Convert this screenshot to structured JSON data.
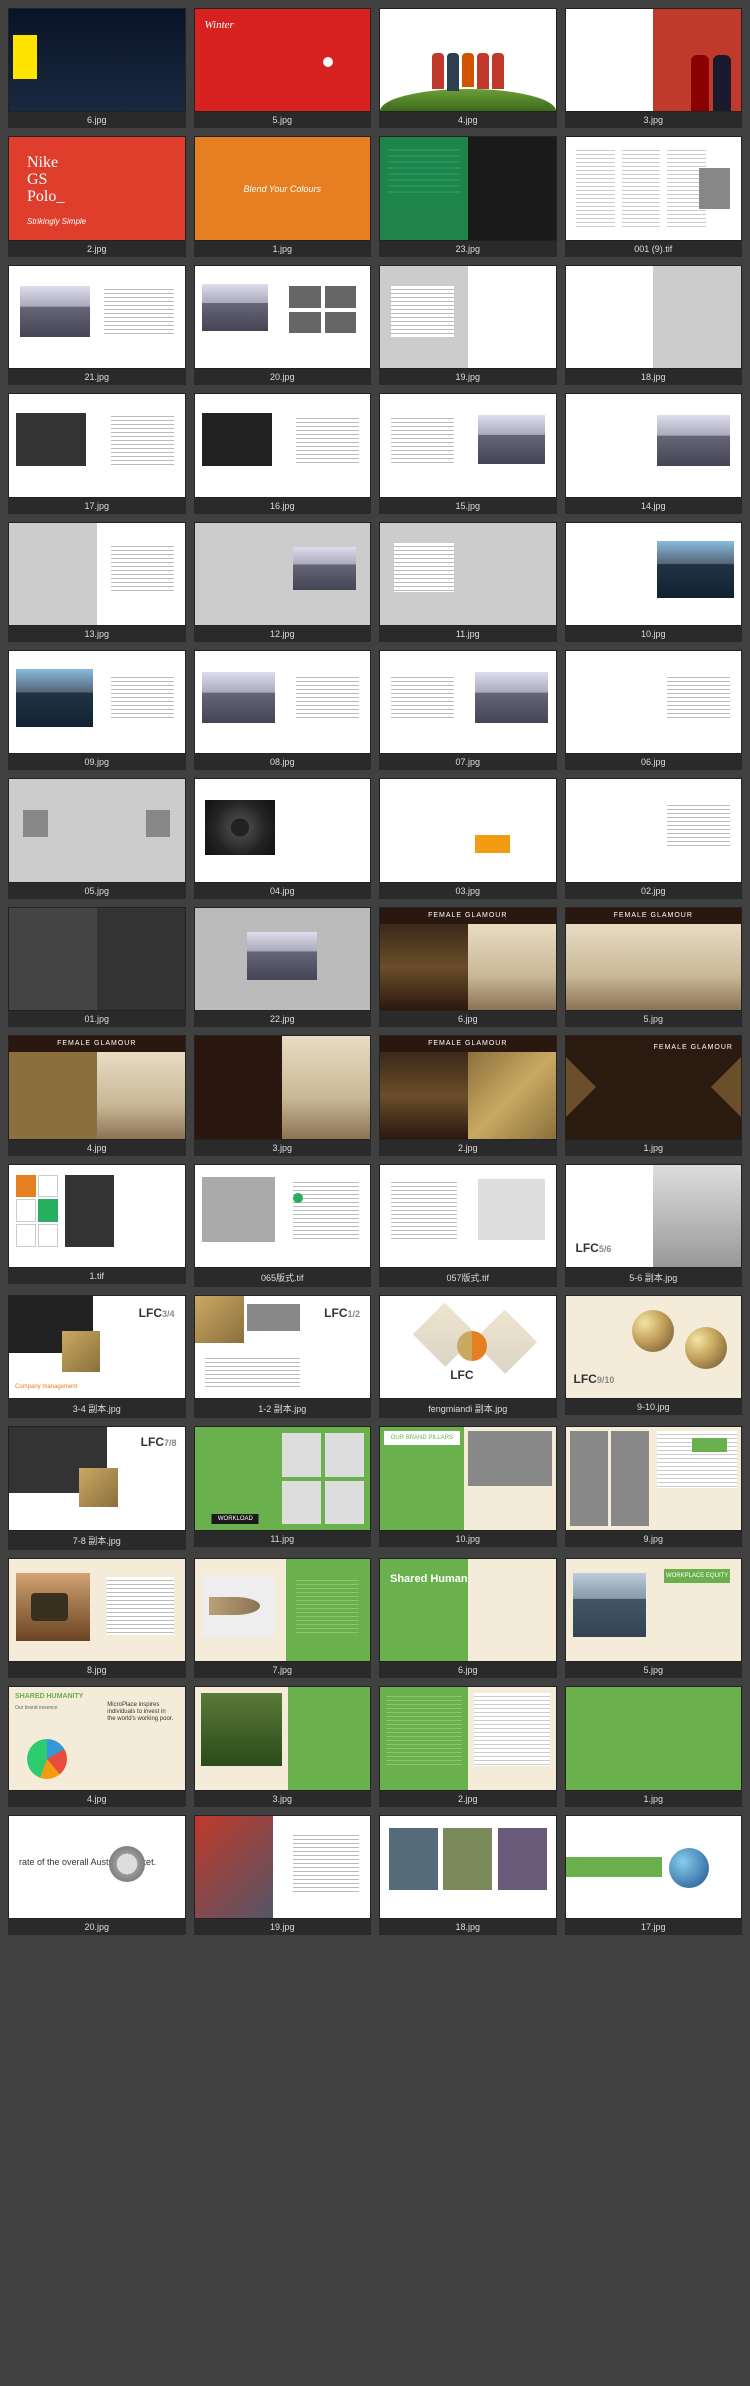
{
  "row1": [
    {
      "label": "6.jpg",
      "nike_text": ""
    },
    {
      "label": "5.jpg",
      "tagline": "Winter"
    },
    {
      "label": "4.jpg"
    },
    {
      "label": "3.jpg"
    }
  ],
  "row2": [
    {
      "label": "2.jpg",
      "headline": "Nike\nGS\nPolo_",
      "sub": "Strikingly Simple"
    },
    {
      "label": "1.jpg",
      "text": "Blend Your Colours"
    },
    {
      "label": "23.jpg"
    },
    {
      "label": "001 (9).tif"
    }
  ],
  "cars": [
    {
      "label": "21.jpg"
    },
    {
      "label": "20.jpg"
    },
    {
      "label": "19.jpg"
    },
    {
      "label": "18.jpg"
    },
    {
      "label": "17.jpg"
    },
    {
      "label": "16.jpg"
    },
    {
      "label": "15.jpg"
    },
    {
      "label": "14.jpg"
    },
    {
      "label": "13.jpg"
    },
    {
      "label": "12.jpg"
    },
    {
      "label": "11.jpg"
    },
    {
      "label": "10.jpg"
    },
    {
      "label": "09.jpg"
    },
    {
      "label": "08.jpg"
    },
    {
      "label": "07.jpg"
    },
    {
      "label": "06.jpg"
    },
    {
      "label": "05.jpg"
    },
    {
      "label": "04.jpg"
    },
    {
      "label": "03.jpg"
    },
    {
      "label": "02.jpg"
    }
  ],
  "glamour_row1": [
    {
      "label": "01.jpg"
    },
    {
      "label": "22.jpg"
    },
    {
      "label": "6.jpg",
      "title": "FEMALE GLAMOUR"
    },
    {
      "label": "5.jpg",
      "title": "FEMALE GLAMOUR"
    }
  ],
  "glamour_row2": [
    {
      "label": "4.jpg",
      "title": "FEMALE GLAMOUR"
    },
    {
      "label": "3.jpg"
    },
    {
      "label": "2.jpg",
      "title": "FEMALE GLAMOUR"
    },
    {
      "label": "1.jpg",
      "title": "FEMALE GLAMOUR"
    }
  ],
  "lfc_row1": [
    {
      "label": "1.tif"
    },
    {
      "label": "065版式.tif"
    },
    {
      "label": "057版式.tif"
    },
    {
      "label": "5-6 副本.jpg",
      "lfc": "LFC",
      "frac": "5/6"
    }
  ],
  "lfc_row2": [
    {
      "label": "3-4 副本.jpg",
      "lfc": "LFC",
      "frac": "3/4",
      "sub": "Company management"
    },
    {
      "label": "1-2 副本.jpg",
      "lfc": "LFC",
      "frac": "1/2"
    },
    {
      "label": "fengmiandi 副本.jpg",
      "lfc": "LFC"
    },
    {
      "label": "9-10.jpg",
      "lfc": "LFC",
      "frac": "9/10"
    }
  ],
  "green_row1": [
    {
      "label": "7-8 副本.jpg",
      "lfc": "LFC",
      "frac": "7/8"
    },
    {
      "label": "11.jpg",
      "title": "WORKLOAD"
    },
    {
      "label": "10.jpg",
      "title": "OUR BRAND PILLARS"
    },
    {
      "label": "9.jpg"
    }
  ],
  "green_row2": [
    {
      "label": "8.jpg"
    },
    {
      "label": "7.jpg"
    },
    {
      "label": "6.jpg",
      "title": "Shared Humanity."
    },
    {
      "label": "5.jpg",
      "title": "WORKPLACE EQUITY"
    }
  ],
  "green_row3": [
    {
      "label": "4.jpg",
      "title": "SHARED HUMANITY",
      "sub": "Our brand essence",
      "ins": "MicroPlace inspires individuals to invest in the world's working poor."
    },
    {
      "label": "3.jpg"
    },
    {
      "label": "2.jpg"
    },
    {
      "label": "1.jpg"
    }
  ],
  "bottom": [
    {
      "label": "20.jpg",
      "text": "rate of the overall Austrian market."
    },
    {
      "label": "19.jpg"
    },
    {
      "label": "18.jpg"
    },
    {
      "label": "17.jpg"
    }
  ]
}
